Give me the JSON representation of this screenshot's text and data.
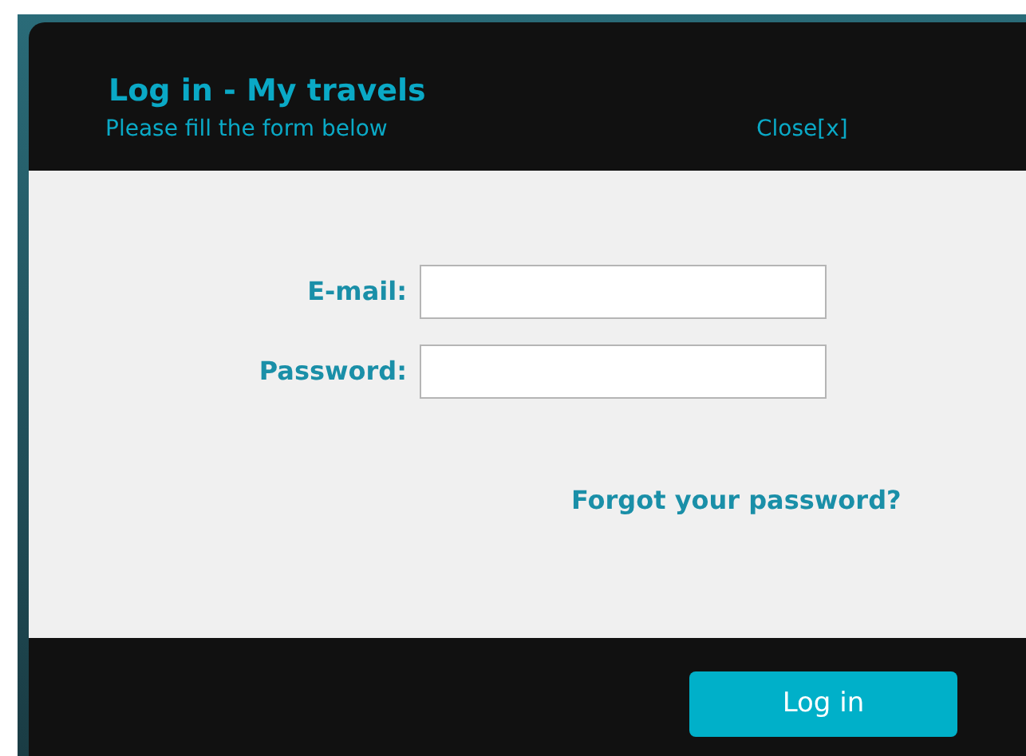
{
  "dialog": {
    "title": "Log in - My travels",
    "subtitle": "Please fill the form below",
    "close": "Close[x]"
  },
  "fields": [
    {
      "label": "E-mail:"
    },
    {
      "label": "Password:"
    }
  ],
  "forgot_link": "Forgot your password?",
  "submit": "Log in"
}
